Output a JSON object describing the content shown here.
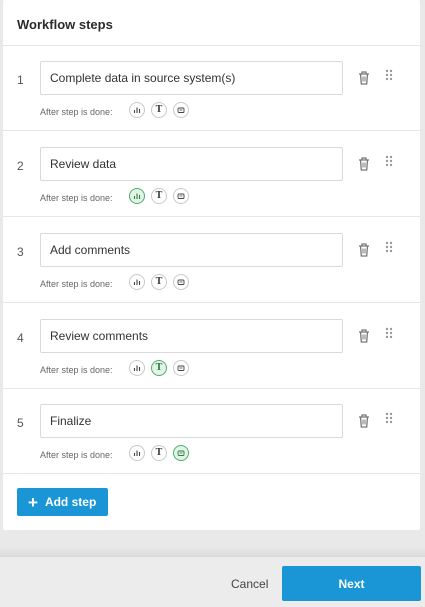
{
  "panel": {
    "title": "Workflow steps"
  },
  "steps": [
    {
      "number": "1",
      "value": "Complete data in source system(s)",
      "after_label": "After step is done:",
      "selected_option": ""
    },
    {
      "number": "2",
      "value": "Review data",
      "after_label": "After step is done:",
      "selected_option": "chart"
    },
    {
      "number": "3",
      "value": "Add comments",
      "after_label": "After step is done:",
      "selected_option": ""
    },
    {
      "number": "4",
      "value": "Review comments",
      "after_label": "After step is done:",
      "selected_option": "text"
    },
    {
      "number": "5",
      "value": "Finalize",
      "after_label": "After step is done:",
      "selected_option": "message"
    }
  ],
  "option_icons": {
    "chart": "bar-chart-icon",
    "text": "text-T-icon",
    "message": "message-icon",
    "text_glyph": "T"
  },
  "actions": {
    "add_step": "Add step",
    "add_icon": "+",
    "cancel": "Cancel",
    "next": "Next"
  },
  "colors": {
    "accent": "#1a95d6",
    "selected_border": "#4caf6a",
    "selected_fill": "#e3f4e7"
  }
}
